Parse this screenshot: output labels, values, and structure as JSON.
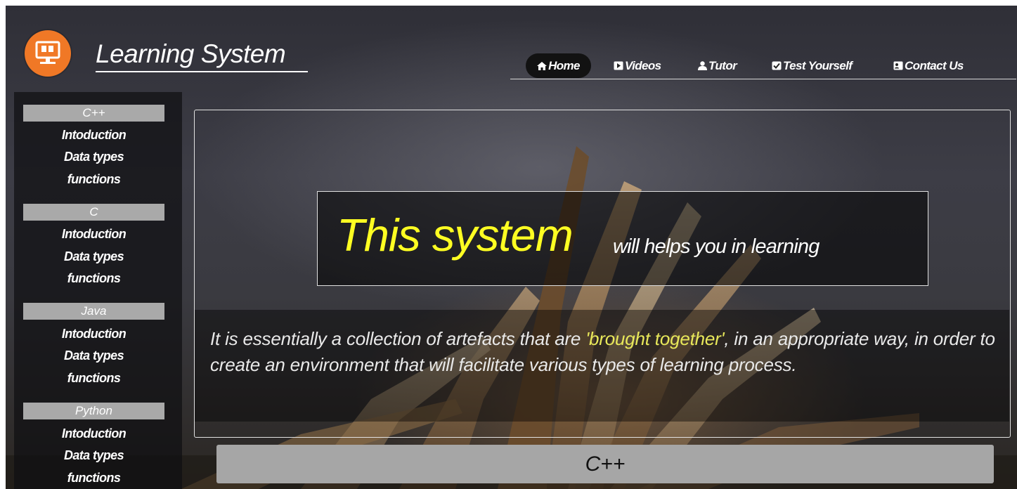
{
  "brand": {
    "title": "Learning System",
    "logo_icon": "computer-screen-icon",
    "logo_color": "#f07826"
  },
  "nav": {
    "items": [
      {
        "label": "Home",
        "icon": "home-icon",
        "active": true
      },
      {
        "label": "Videos",
        "icon": "play-icon"
      },
      {
        "label": "Tutor",
        "icon": "user-icon"
      },
      {
        "label": "Test Yourself",
        "icon": "checkbox-icon"
      },
      {
        "label": "Contact Us",
        "icon": "contact-card-icon"
      }
    ]
  },
  "sidebar": {
    "groups": [
      {
        "title": "C++",
        "links": [
          "Intoduction",
          "Data types",
          "functions"
        ]
      },
      {
        "title": "C",
        "links": [
          "Intoduction",
          "Data types",
          "functions"
        ]
      },
      {
        "title": "Java",
        "links": [
          "Intoduction",
          "Data types",
          "functions"
        ]
      },
      {
        "title": "Python",
        "links": [
          "Intoduction",
          "Data types",
          "functions"
        ]
      }
    ]
  },
  "hero": {
    "headline": "This system",
    "tagline": "will helps you in learning",
    "headline_color": "#ffff22"
  },
  "description": {
    "before": "It is essentially a collection of artefacts that are ",
    "highlight": "'brought together'",
    "after": ", in an appropriate way, in order to create an environment that will facilitate various types of learning process.",
    "highlight_color": "#e8e85a"
  },
  "topic_bar": {
    "label": "C++"
  }
}
